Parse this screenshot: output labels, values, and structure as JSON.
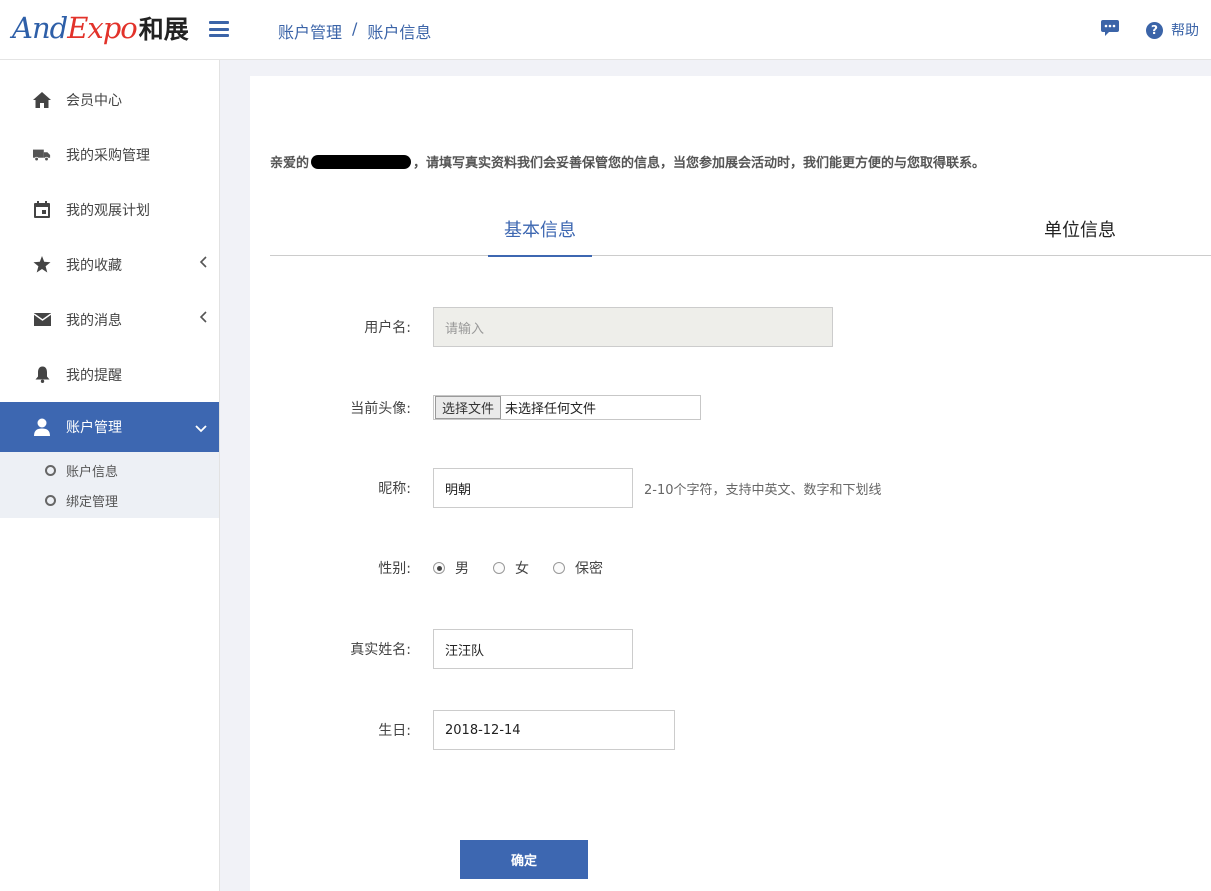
{
  "header": {
    "logo_and": "And",
    "logo_expo": "Expo",
    "logo_cn": "和展",
    "breadcrumb": [
      "账户管理",
      "/",
      "账户信息"
    ],
    "help_label": "帮助",
    "icons": {
      "menu": "hamburger-icon",
      "chat": "chat-icon",
      "help": "question-circle-icon"
    }
  },
  "sidebar": {
    "items": [
      {
        "label": "会员中心",
        "icon": "home-icon"
      },
      {
        "label": "我的采购管理",
        "icon": "truck-icon"
      },
      {
        "label": "我的观展计划",
        "icon": "calendar-icon"
      },
      {
        "label": "我的收藏",
        "icon": "star-icon",
        "chevron": "‹"
      },
      {
        "label": "我的消息",
        "icon": "envelope-icon",
        "chevron": "‹"
      },
      {
        "label": "我的提醒",
        "icon": "bell-icon"
      },
      {
        "label": "账户管理",
        "icon": "user-icon",
        "chevron": "⌄",
        "active": true
      }
    ],
    "submenu": [
      {
        "label": "账户信息"
      },
      {
        "label": "绑定管理"
      }
    ]
  },
  "main": {
    "greeting_prefix": "亲爱的",
    "greeting_suffix": "，请填写真实资料我们会妥善保管您的信息，当您参加展会活动时，我们能更方便的与您取得联系。",
    "tabs": [
      {
        "label": "基本信息",
        "active": true
      },
      {
        "label": "单位信息",
        "active": false
      }
    ],
    "form": {
      "username": {
        "label": "用户名:",
        "placeholder": "请输入"
      },
      "avatar": {
        "label": "当前头像:",
        "button": "选择文件",
        "status": "未选择任何文件"
      },
      "nickname": {
        "label": "昵称:",
        "value": "明朝",
        "hint": "2-10个字符，支持中英文、数字和下划线"
      },
      "gender": {
        "label": "性别:",
        "options": [
          "男",
          "女",
          "保密"
        ],
        "selected": "男"
      },
      "realname": {
        "label": "真实姓名:",
        "value": "汪汪队"
      },
      "birthday": {
        "label": "生日:",
        "value": "2018-12-14"
      },
      "submit": "确定"
    }
  },
  "colors": {
    "accent": "#3d67b1",
    "logo_blue": "#2e5fa8",
    "logo_red": "#e2322a"
  }
}
